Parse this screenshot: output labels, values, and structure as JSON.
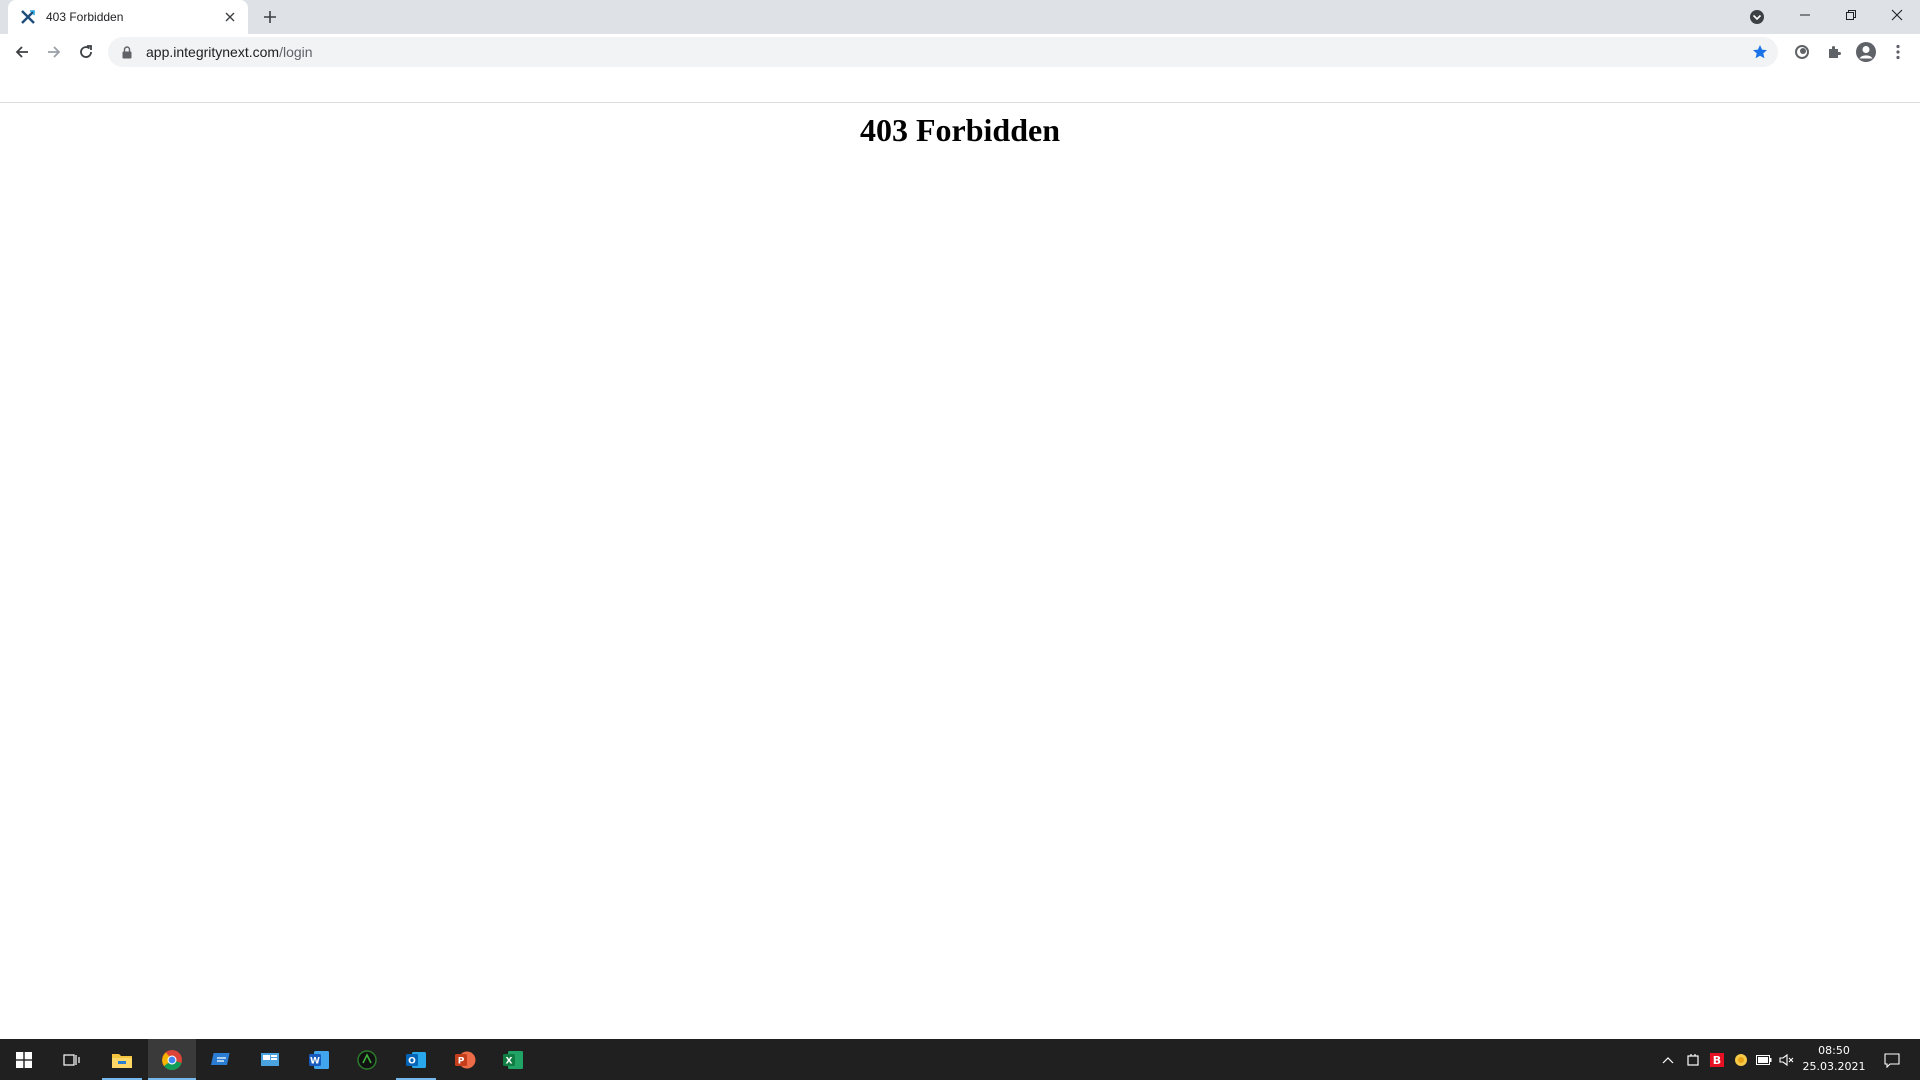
{
  "browser": {
    "tab": {
      "title": "403 Forbidden"
    },
    "address_bar": {
      "host": "app.integritynext.com",
      "path": "/login"
    }
  },
  "page": {
    "heading": "403 Forbidden"
  },
  "taskbar": {
    "apps": [
      "windows-start",
      "task-view",
      "file-explorer",
      "chrome",
      "remote-desktop",
      "control-panel",
      "word",
      "app-green",
      "outlook",
      "powerpoint",
      "excel"
    ],
    "clock": {
      "time": "08:50",
      "date": "25.03.2021"
    }
  },
  "colors": {
    "tab_strip": "#dee1e6",
    "taskbar": "#202020",
    "accent": "#1a73e8"
  }
}
